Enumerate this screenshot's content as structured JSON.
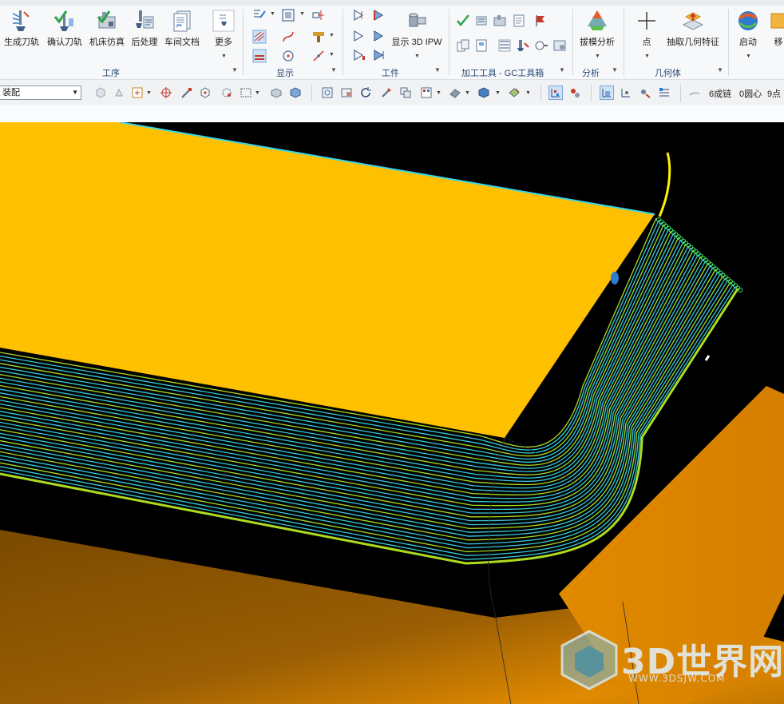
{
  "ribbon": {
    "buttons": {
      "generate_toolpath": "生成刀轨",
      "verify_toolpath": "确认刀轨",
      "machine_simulate": "机床仿真",
      "postprocess": "后处理",
      "shop_doc": "车间文档",
      "more": "更多",
      "show_3d_ipw": "显示 3D IPW",
      "draft_analysis": "拔模分析",
      "point": "点",
      "extract_geometry": "抽取几何特征",
      "start": "启动",
      "move_cut": "移"
    },
    "groups": {
      "operation": "工序",
      "display": "显示",
      "workpiece": "工件",
      "gc_toolkit": "加工工具 - GC工具箱",
      "analysis": "分析",
      "geometry": "几何体"
    }
  },
  "toolbar2": {
    "filter_value": "装配",
    "chain_status": "6成链",
    "arc_status": "0圆心",
    "point_status": "9点"
  },
  "watermark": {
    "text": "3D世界网",
    "url": "WWW.3DSJW.COM"
  },
  "viewport": {
    "background": "#000000",
    "top_face_color": "#FFC000",
    "side_face_color": "#E08A00",
    "toolpath_color": "#3AD6E8",
    "toolpath_highlight": "#B6E820",
    "highlight_arc_color": "#FFF200"
  }
}
